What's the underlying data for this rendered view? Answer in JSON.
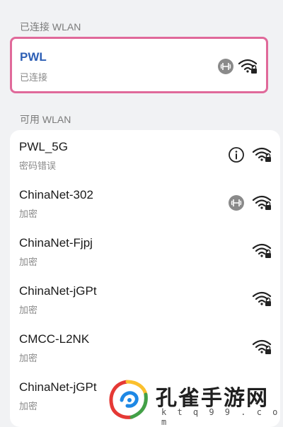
{
  "sections": {
    "connected_header": "已连接 WLAN",
    "available_header": "可用 WLAN"
  },
  "connected": {
    "ssid": "PWL",
    "status": "已连接",
    "highlight_color": "#e0699a",
    "icons": [
      "hotspot-badge-icon",
      "wifi-locked-icon"
    ]
  },
  "available": [
    {
      "ssid": "PWL_5G",
      "status": "密码错误",
      "icons": [
        "info-icon",
        "wifi-locked-icon"
      ]
    },
    {
      "ssid": "ChinaNet-302",
      "status": "加密",
      "icons": [
        "hotspot-badge-icon",
        "wifi-locked-icon"
      ]
    },
    {
      "ssid": "ChinaNet-Fjpj",
      "status": "加密",
      "icons": [
        "wifi-locked-icon"
      ]
    },
    {
      "ssid": "ChinaNet-jGPt",
      "status": "加密",
      "icons": [
        "wifi-locked-icon"
      ]
    },
    {
      "ssid": "CMCC-L2NK",
      "status": "加密",
      "icons": [
        "wifi-locked-icon"
      ]
    },
    {
      "ssid": "ChinaNet-jGPt",
      "status": "加密",
      "icons": []
    }
  ],
  "watermark": {
    "text": "孔雀手游网",
    "url": "k t q 9 9 . c o m"
  },
  "colors": {
    "background": "#f1f2f4",
    "card": "#ffffff",
    "active_ssid": "#2d5fb5"
  }
}
